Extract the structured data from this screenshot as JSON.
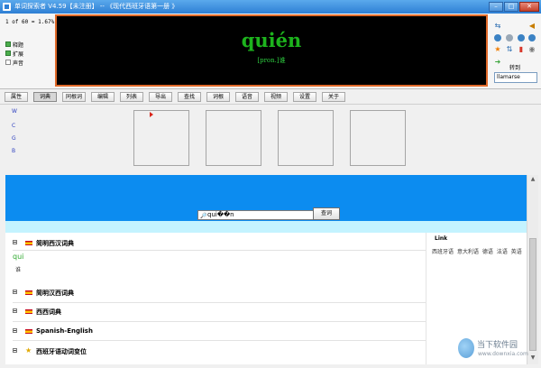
{
  "window": {
    "title": "单词探索者 V4.59【未注册】 -- 《现代西班牙语第一册 》",
    "buttons": [
      "–",
      "□",
      "✕"
    ]
  },
  "status": {
    "counter": "1 of 60 = 1.67%"
  },
  "options": [
    {
      "label": "释题",
      "checked": true
    },
    {
      "label": "扩展",
      "checked": true
    },
    {
      "label": "声音",
      "checked": false
    }
  ],
  "display": {
    "word": "quién",
    "pron": "[pron.]谁"
  },
  "right_panel": {
    "goto_label": "转到",
    "goto_value": "llamarse"
  },
  "tabs": [
    "属性",
    "词典",
    "同根词",
    "编辑",
    "列表",
    "导出",
    "查找",
    "词根",
    "语音",
    "视频",
    "设置",
    "关于"
  ],
  "active_tab": "词典",
  "side_links": [
    "W",
    "C",
    "G",
    "B"
  ],
  "search": {
    "value": "qui��n",
    "button": "查词"
  },
  "dictionaries": [
    {
      "name": "简明西汉词典",
      "flag": "es"
    },
    {
      "name": "简明汉西词典",
      "flag": "es"
    },
    {
      "name": "西西词典",
      "flag": "es"
    },
    {
      "name": "Spanish-English",
      "flag": "es"
    },
    {
      "name": "西班牙语动词变位",
      "flag": "star"
    }
  ],
  "entry": {
    "word": "qui",
    "def": "谁"
  },
  "link_panel": {
    "title": "Link",
    "items": [
      "西班牙语",
      "意大利语",
      "德语",
      "法语",
      "英语"
    ]
  },
  "watermark": {
    "title": "当下软件园",
    "subtitle": "www.downxia.com"
  }
}
